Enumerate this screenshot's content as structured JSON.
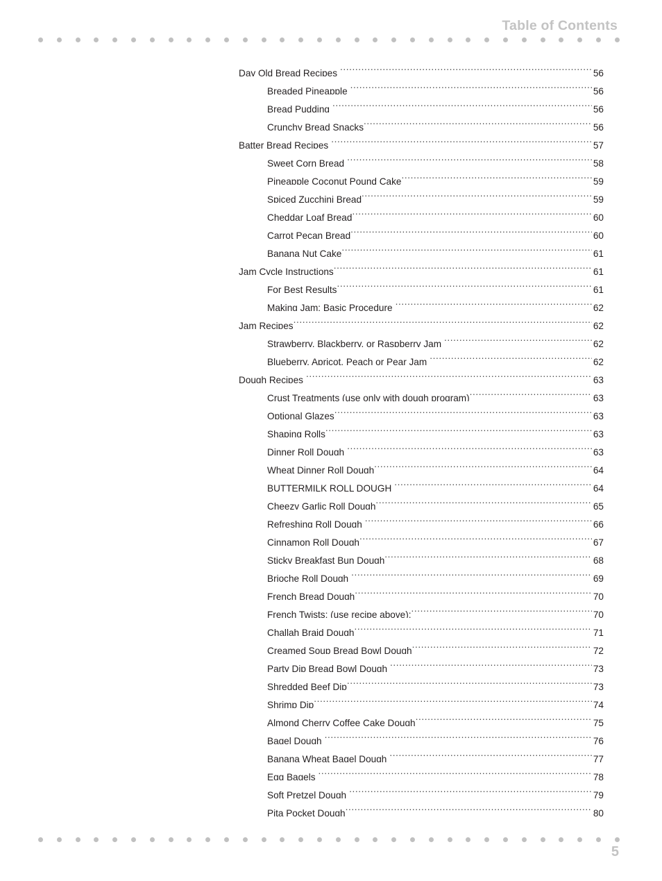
{
  "document": {
    "page_label": "5",
    "background_color": "#ffffff",
    "accent_gray": "#c3c3c3",
    "text_color": "#231f20"
  },
  "header": {
    "title": "Table of Contents"
  },
  "decoration": {
    "dot_count": 32,
    "dot_color": "#c0c0c0"
  },
  "toc": {
    "leader_char": ".",
    "entries": [
      {
        "level": 1,
        "label": "Day Old Bread Recipes",
        "page": "56",
        "gap": true
      },
      {
        "level": 2,
        "label": "Breaded Pineapple",
        "page": "56",
        "gap": true
      },
      {
        "level": 2,
        "label": "Bread Pudding",
        "page": "56",
        "gap": true
      },
      {
        "level": 2,
        "label": "Crunchy Bread Snacks",
        "page": "56",
        "gap": false
      },
      {
        "level": 1,
        "label": "Batter Bread Recipes",
        "page": "57",
        "gap": true
      },
      {
        "level": 2,
        "label": "Sweet Corn Bread",
        "page": "58",
        "gap": true
      },
      {
        "level": 2,
        "label": "Pineapple Coconut Pound Cake",
        "page": "59",
        "gap": false
      },
      {
        "level": 2,
        "label": "Spiced Zucchini Bread",
        "page": "59",
        "gap": false
      },
      {
        "level": 2,
        "label": "Cheddar Loaf Bread",
        "page": "60",
        "gap": false
      },
      {
        "level": 2,
        "label": "Carrot Pecan Bread",
        "page": "60",
        "gap": false
      },
      {
        "level": 2,
        "label": "Banana Nut Cake",
        "page": "61",
        "gap": false
      },
      {
        "level": 1,
        "label": "Jam Cycle Instructions",
        "page": "61",
        "gap": false
      },
      {
        "level": 2,
        "label": "For Best Results",
        "page": "61",
        "gap": false
      },
      {
        "level": 2,
        "label": "Making Jam: Basic Procedure",
        "page": "62",
        "gap": true
      },
      {
        "level": 1,
        "label": "Jam Recipes",
        "page": "62",
        "gap": false
      },
      {
        "level": 2,
        "label": "Strawberry, Blackberry, or Raspberry Jam",
        "page": "62",
        "gap": true
      },
      {
        "level": 2,
        "label": "Blueberry, Apricot, Peach or Pear Jam",
        "page": "62",
        "gap": true
      },
      {
        "level": 1,
        "label": "Dough Recipes",
        "page": "63",
        "gap": true
      },
      {
        "level": 2,
        "label": "Crust Treatments (use only with dough program)",
        "page": "63",
        "gap": false
      },
      {
        "level": 2,
        "label": "Optional Glazes",
        "page": "63",
        "gap": false
      },
      {
        "level": 2,
        "label": "Shaping Rolls",
        "page": "63",
        "gap": false
      },
      {
        "level": 2,
        "label": "Dinner Roll Dough",
        "page": "63",
        "gap": true
      },
      {
        "level": 2,
        "label": "Wheat Dinner Roll Dough",
        "page": "64",
        "gap": false
      },
      {
        "level": 2,
        "label": "BUTTERMILK ROLL DOUGH",
        "page": "64",
        "gap": true
      },
      {
        "level": 2,
        "label": "Cheezy Garlic Roll Dough",
        "page": "65",
        "gap": false
      },
      {
        "level": 2,
        "label": "Refreshing Roll Dough",
        "page": "66",
        "gap": true
      },
      {
        "level": 2,
        "label": "Cinnamon Roll Dough",
        "page": "67",
        "gap": false
      },
      {
        "level": 2,
        "label": "Sticky Breakfast Bun Dough",
        "page": "68",
        "gap": false
      },
      {
        "level": 2,
        "label": "Brioche Roll Dough",
        "page": "69",
        "gap": true
      },
      {
        "level": 2,
        "label": "French Bread Dough",
        "page": "70",
        "gap": false
      },
      {
        "level": 2,
        "label": "French Twists: (use recipe above):",
        "page": "70",
        "gap": false
      },
      {
        "level": 2,
        "label": "Challah Braid Dough",
        "page": "71",
        "gap": false
      },
      {
        "level": 2,
        "label": "Creamed Soup Bread Bowl Dough",
        "page": "72",
        "gap": false
      },
      {
        "level": 2,
        "label": "Party Dip Bread Bowl Dough",
        "page": "73",
        "gap": true
      },
      {
        "level": 2,
        "label": "Shredded Beef Dip",
        "page": "73",
        "gap": false
      },
      {
        "level": 2,
        "label": "Shrimp Dip",
        "page": "74",
        "gap": false
      },
      {
        "level": 2,
        "label": "Almond Cherry Coffee Cake Dough",
        "page": "75",
        "gap": false
      },
      {
        "level": 2,
        "label": "Bagel Dough",
        "page": "76",
        "gap": true
      },
      {
        "level": 2,
        "label": "Banana Wheat Bagel Dough",
        "page": "77",
        "gap": true
      },
      {
        "level": 2,
        "label": "Egg Bagels",
        "page": "78",
        "gap": true
      },
      {
        "level": 2,
        "label": "Soft Pretzel Dough",
        "page": "79",
        "gap": true
      },
      {
        "level": 2,
        "label": "Pita Pocket Dough",
        "page": "80",
        "gap": false
      }
    ]
  }
}
